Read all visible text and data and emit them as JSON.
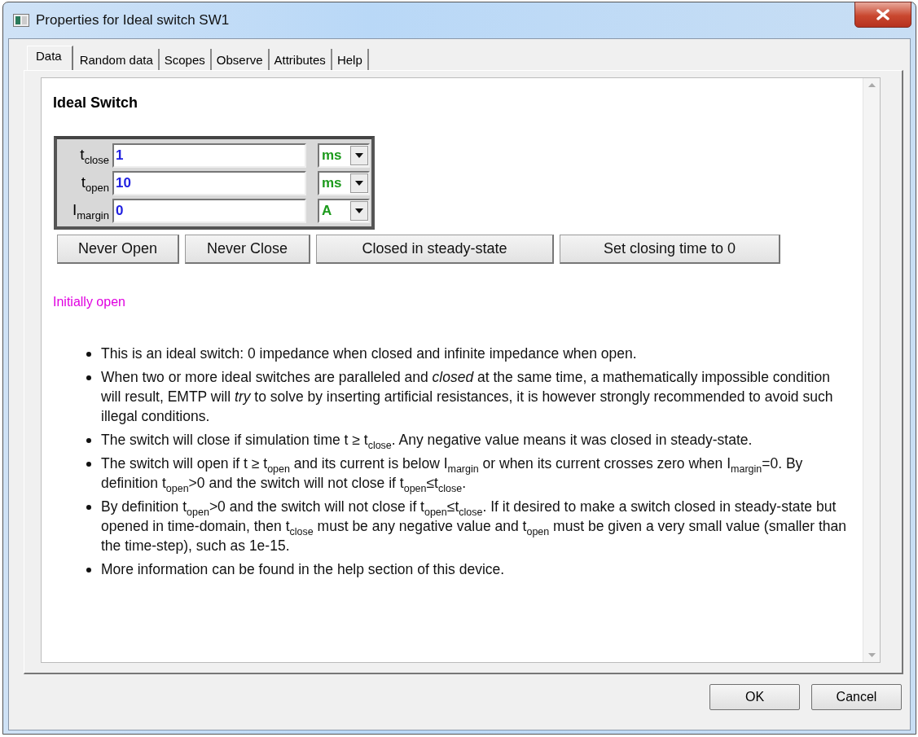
{
  "window": {
    "title": "Properties for Ideal switch SW1"
  },
  "tabs": [
    {
      "label": "Data",
      "selected": true
    },
    {
      "label": "Random data",
      "selected": false
    },
    {
      "label": "Scopes",
      "selected": false
    },
    {
      "label": "Observe",
      "selected": false
    },
    {
      "label": "Attributes",
      "selected": false
    },
    {
      "label": "Help",
      "selected": false
    }
  ],
  "heading": "Ideal Switch",
  "parameters": [
    {
      "label": "t$_{close}$",
      "value": "1",
      "unit": "ms"
    },
    {
      "label": "t$_{open}$",
      "value": "10",
      "unit": "ms"
    },
    {
      "label": "I$_{margin}$",
      "value": "0",
      "unit": "A"
    }
  ],
  "preset_buttons": [
    "Never Open",
    "Never Close",
    "Closed in steady-state",
    "Set closing time to 0"
  ],
  "status": "Initially open",
  "notes": [
    "This is an ideal switch: 0 impedance when closed and infinite impedance when open.",
    "When two or more ideal switches are paralleled and *closed* at the same time, a mathematically impossible condition will result, EMTP will *try* to solve by inserting artificial resistances, it is however strongly recommended to avoid such illegal conditions.",
    "The switch will close if simulation time t ≥ t$_{close}$. Any negative value means it was closed in steady-state.",
    "The switch will open if t ≥ t$_{open}$ and its current is below I$_{margin}$ or when its current crosses zero when I$_{margin}$=0. By definition t$_{open}$>0 and the switch will not close if t$_{open}$≤t$_{close}$.",
    "By definition t$_{open}$>0 and the switch will not close if t$_{open}$≤t$_{close}$. If it desired to make a switch closed in steady-state but opened in time-domain, then t$_{close}$ must be any negative value and t$_{open}$ must be given a very small value (smaller than the time-step), such as 1e-15.",
    "More information can be found in the help section of this device."
  ],
  "dialog_buttons": [
    "OK",
    "Cancel"
  ]
}
